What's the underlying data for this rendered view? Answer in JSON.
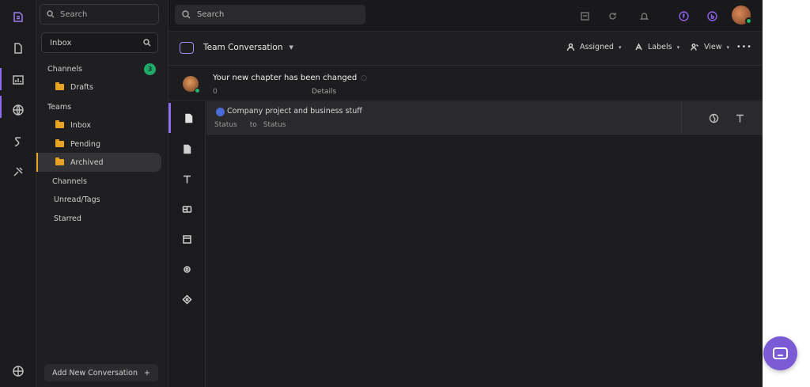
{
  "topbar": {
    "panel_search_placeholder": "Search",
    "main_search_placeholder": "Search",
    "icons": [
      "archive-icon",
      "refresh-icon",
      "bell-icon",
      "brand-f-icon",
      "brand-b-icon"
    ]
  },
  "sidebar": {
    "filter_label": "Inbox",
    "section_a": "Channels",
    "section_a_count": "3",
    "folder_a": "Drafts",
    "section_b": "Teams",
    "folders_b": [
      "Inbox",
      "Pending",
      "Archived"
    ],
    "section_c": "Channels",
    "extra_items": [
      "Unread/Tags",
      "Starred"
    ],
    "new_button_label": "Add New Conversation"
  },
  "toolbar": {
    "title": "Team Conversation",
    "actions": [
      "Assigned",
      "Labels",
      "View"
    ]
  },
  "message": {
    "subject": "Your new chapter has been changed",
    "meta_a": "0",
    "meta_b": "Details"
  },
  "item": {
    "title": "Company project and business stuff",
    "sub": [
      "Status",
      "to",
      "Status"
    ]
  },
  "colors": {
    "accent": "#8b6cf0",
    "folder": "#e8a325",
    "online": "#23b26b",
    "chat_launcher": "#7b5ad6"
  }
}
